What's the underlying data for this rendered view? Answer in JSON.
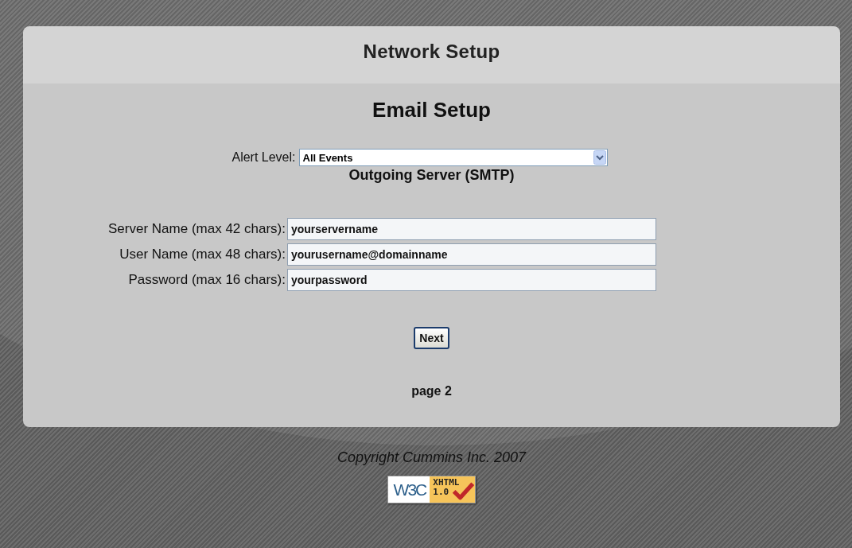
{
  "panel": {
    "title": "Network Setup",
    "heading": "Email Setup"
  },
  "alert_level": {
    "label": "Alert Level:",
    "value": "All Events"
  },
  "section_title": "Outgoing Server (SMTP)",
  "fields": [
    {
      "label": "Server Name (max 42 chars):",
      "value": "yourservername"
    },
    {
      "label": "User Name (max 48 chars):",
      "value": "yourusername@domainname"
    },
    {
      "label": "Password (max 16 chars):",
      "value": "yourpassword"
    }
  ],
  "next_button": "Next",
  "page_label": "page 2",
  "copyright": "Copyright Cummins Inc. 2007",
  "badge": {
    "w3c": "W3C",
    "standard": "XHTML",
    "version": "1.0"
  }
}
